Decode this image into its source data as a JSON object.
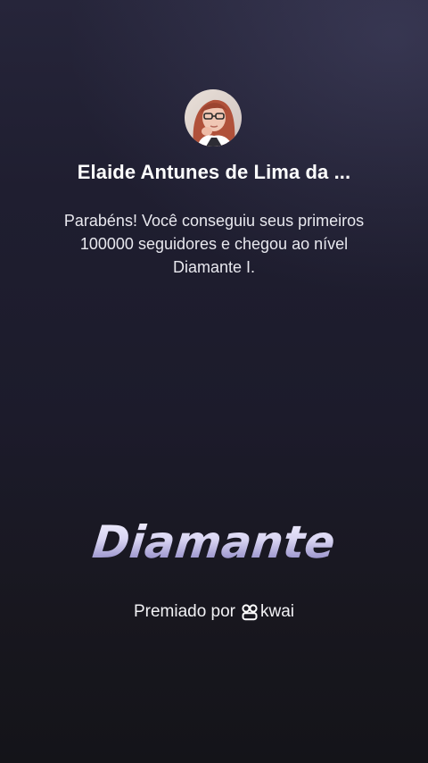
{
  "user": {
    "name": "Elaide Antunes de Lima da ...",
    "avatar": "profile-photo"
  },
  "message": "Parabéns! Você conseguiu seus primeiros 100000 seguidores e chegou ao nível Diamante I.",
  "level": {
    "title": "Diamante"
  },
  "awarded": {
    "prefix": "Premiado por",
    "brand": "kwai",
    "brand_icon": "kwai-logo-icon"
  },
  "colors": {
    "background_top": "#26253a",
    "background_bottom": "#141419",
    "level_gradient_light": "#f4f2ff",
    "level_gradient_dark": "#8c85c2"
  }
}
